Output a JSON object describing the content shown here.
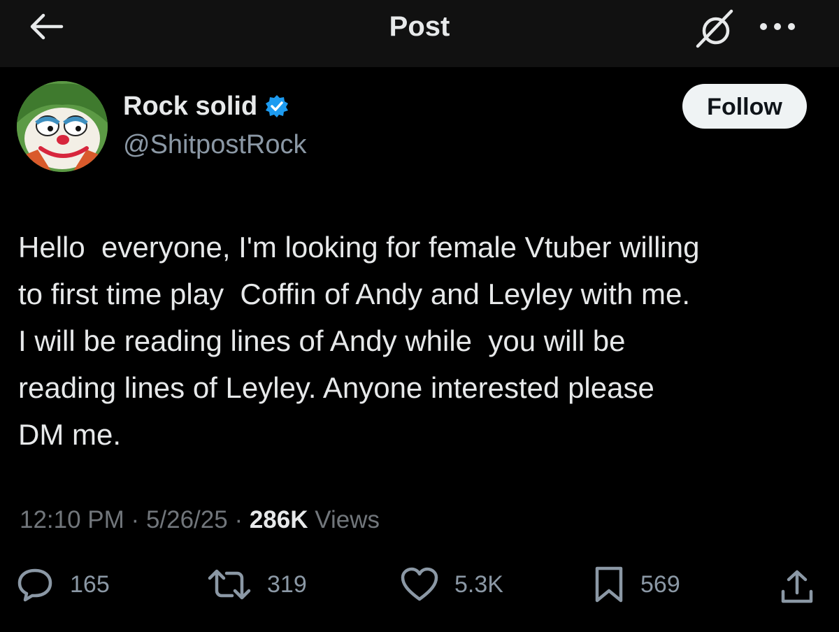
{
  "header": {
    "title": "Post",
    "back_icon": "arrow-left-icon",
    "grok_icon": "grok-icon",
    "more_icon": "more-dots-icon"
  },
  "author": {
    "display_name": "Rock solid",
    "handle": "@ShitpostRock",
    "verified": true,
    "verified_color": "#1d9bf0"
  },
  "follow_button": {
    "label": "Follow"
  },
  "post": {
    "text": "Hello  everyone, I'm looking for female Vtuber willing\nto first time play  Coffin of Andy and Leyley with me.\nI will be reading lines of Andy while  you will be\nreading lines of Leyley. Anyone interested please\nDM me.",
    "time": "12:10 PM",
    "date": "5/26/25",
    "separator": "·",
    "views_count": "286K",
    "views_label": "Views"
  },
  "actions": {
    "replies": "165",
    "reposts": "319",
    "likes": "5.3K",
    "bookmarks": "569"
  },
  "colors": {
    "background": "#000000",
    "header_background": "#111111",
    "primary_text": "#e7e9ea",
    "secondary_text": "#71767b",
    "follow_bg": "#eff3f4"
  }
}
